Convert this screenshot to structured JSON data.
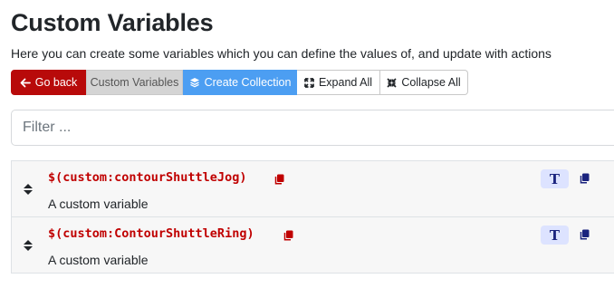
{
  "page": {
    "title": "Custom Variables",
    "description": "Here you can create some variables which you can define the values of, and update with actions"
  },
  "toolbar": {
    "back_label": "Go back",
    "custom_label": "Custom Variables",
    "create_label": "Create Collection",
    "expand_label": "Expand All",
    "collapse_label": "Collapse All"
  },
  "filter": {
    "placeholder": "Filter ...",
    "value": ""
  },
  "variables": [
    {
      "name": "$(custom:contourShuttleJog)",
      "description": "A custom variable",
      "type_badge": "T"
    },
    {
      "name": "$(custom:ContourShuttleRing)",
      "description": "A custom variable",
      "type_badge": "T"
    }
  ],
  "colors": {
    "accent_red": "#b80a0a",
    "variable_red": "#c00000",
    "primary_blue": "#4c9ef2",
    "badge_bg": "#dde3ff",
    "badge_fg": "#1a237e"
  },
  "icons": {
    "back": "arrow-left-icon",
    "create": "layers-icon",
    "expand": "expand-arrows-icon",
    "collapse": "compress-arrows-icon",
    "drag": "sort-handle-icon",
    "copy": "copy-icon"
  }
}
